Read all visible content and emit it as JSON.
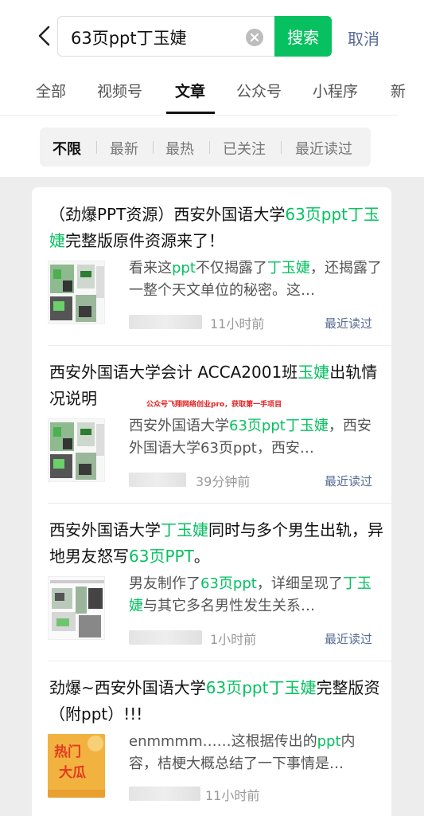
{
  "header": {
    "search_query": "63页ppt丁玉婕",
    "search_button": "搜索",
    "cancel_button": "取消"
  },
  "tabs": [
    {
      "label": "全部"
    },
    {
      "label": "视频号"
    },
    {
      "label": "文章"
    },
    {
      "label": "公众号"
    },
    {
      "label": "小程序"
    },
    {
      "label": "新"
    }
  ],
  "filters": [
    {
      "label": "不限"
    },
    {
      "label": "最新"
    },
    {
      "label": "最热"
    },
    {
      "label": "已关注"
    },
    {
      "label": "最近读过"
    }
  ],
  "watermark": "公众号飞翔网络创业pro，获取第一手项目",
  "results": [
    {
      "title_parts": [
        {
          "text": "（劲爆PPT资源）西安外国语大学",
          "hl": false
        },
        {
          "text": "63页ppt丁玉婕",
          "hl": true
        },
        {
          "text": "完整版原件资源来了！",
          "hl": false
        }
      ],
      "desc_parts": [
        {
          "text": "看来这",
          "hl": false
        },
        {
          "text": "ppt",
          "hl": true
        },
        {
          "text": "不仅揭露了",
          "hl": false
        },
        {
          "text": "丁玉婕",
          "hl": true
        },
        {
          "text": "，还揭露了一整个天文单位的秘密。这…",
          "hl": false
        }
      ],
      "time": "11小时前",
      "recent_label": "最近读过"
    },
    {
      "title_parts": [
        {
          "text": "西安外国语大学会计 ACCA2001班",
          "hl": false
        },
        {
          "text": "玉婕",
          "hl": true
        },
        {
          "text": "出轨情况说明",
          "hl": false
        }
      ],
      "desc_parts": [
        {
          "text": "西安外国语大学",
          "hl": false
        },
        {
          "text": "63页ppt丁玉婕",
          "hl": true
        },
        {
          "text": "，西安外国语大学63页ppt，西安…",
          "hl": false
        }
      ],
      "time": "39分钟前",
      "recent_label": "最近读过"
    },
    {
      "title_parts": [
        {
          "text": "西安外国语大学",
          "hl": false
        },
        {
          "text": "丁玉婕",
          "hl": true
        },
        {
          "text": "同时与多个男生出轨，异地男友怒写",
          "hl": false
        },
        {
          "text": "63页PPT",
          "hl": true
        },
        {
          "text": "。",
          "hl": false
        }
      ],
      "desc_parts": [
        {
          "text": "男友制作了",
          "hl": false
        },
        {
          "text": "63页ppt",
          "hl": true
        },
        {
          "text": "，详细呈现了",
          "hl": false
        },
        {
          "text": "丁玉婕",
          "hl": true
        },
        {
          "text": "与其它多名男性发生关系…",
          "hl": false
        }
      ],
      "time": "1小时前",
      "recent_label": "最近读过"
    },
    {
      "title_parts": [
        {
          "text": "劲爆~西安外国语大学",
          "hl": false
        },
        {
          "text": "63页ppt丁玉婕",
          "hl": true
        },
        {
          "text": "完整版资（附ppt）!!!",
          "hl": false
        }
      ],
      "desc_parts": [
        {
          "text": "enmmmm……这根据传出的",
          "hl": false
        },
        {
          "text": "ppt",
          "hl": true
        },
        {
          "text": "内容，桔梗大概总结了一下事情是…",
          "hl": false
        }
      ],
      "time": "11小时前",
      "thumb_text": [
        "热门",
        "大瓜"
      ]
    }
  ]
}
